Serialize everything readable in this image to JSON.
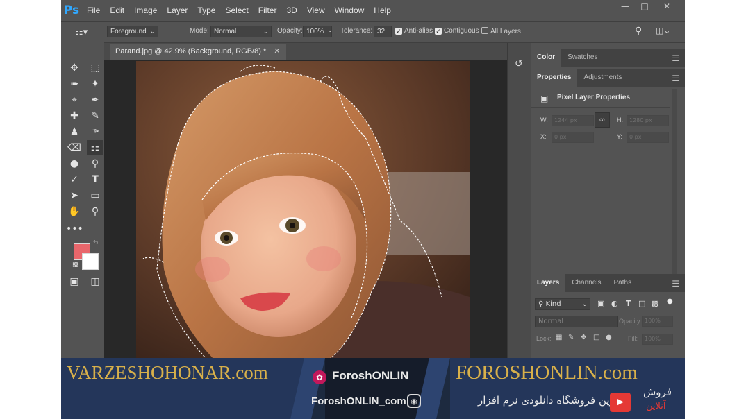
{
  "menubar": {
    "logo": "Ps",
    "items": [
      "File",
      "Edit",
      "Image",
      "Layer",
      "Type",
      "Select",
      "Filter",
      "3D",
      "View",
      "Window",
      "Help"
    ]
  },
  "options_bar": {
    "fill_source": "Foreground",
    "mode_label": "Mode:",
    "mode_value": "Normal",
    "opacity_label": "Opacity:",
    "opacity_value": "100%",
    "tolerance_label": "Tolerance:",
    "tolerance_value": "32",
    "anti_alias_label": "Anti-alias",
    "contiguous_label": "Contiguous",
    "all_layers_label": "All Layers"
  },
  "document": {
    "tab_title": "Parand.jpg @ 42.9% (Background, RGB/8) *"
  },
  "colors": {
    "foreground": "#e8666b",
    "background": "#ffffff",
    "ps_blue": "#31a8ff"
  },
  "panels": {
    "color_tabs": [
      "Color",
      "Swatches"
    ],
    "properties_tabs": [
      "Properties",
      "Adjustments"
    ],
    "properties_title": "Pixel Layer Properties",
    "w_label": "W:",
    "w_value": "1244 px",
    "h_label": "H:",
    "h_value": "1280 px",
    "x_label": "X:",
    "x_value": "0 px",
    "y_label": "Y:",
    "y_value": "0 px",
    "layers_tabs": [
      "Layers",
      "Channels",
      "Paths"
    ],
    "kind_label": "Kind",
    "blend_mode": "Normal",
    "opacity_label": "Opacity:",
    "opacity_value": "100%",
    "lock_label": "Lock:",
    "fill_label": "Fill:",
    "fill_value": "100%"
  },
  "watermark": {
    "left_site": "VARZESHOHONAR.com",
    "center_brand": "ForoshONLIN",
    "center_site": "ForoshONLIN_com",
    "right_site": "FOROSHONLIN.com",
    "right_slogan": "برترین فروشگاه دانلودی نرم افزار",
    "right_logo_text": "فروش",
    "right_logo_sub": "آنلاین"
  }
}
